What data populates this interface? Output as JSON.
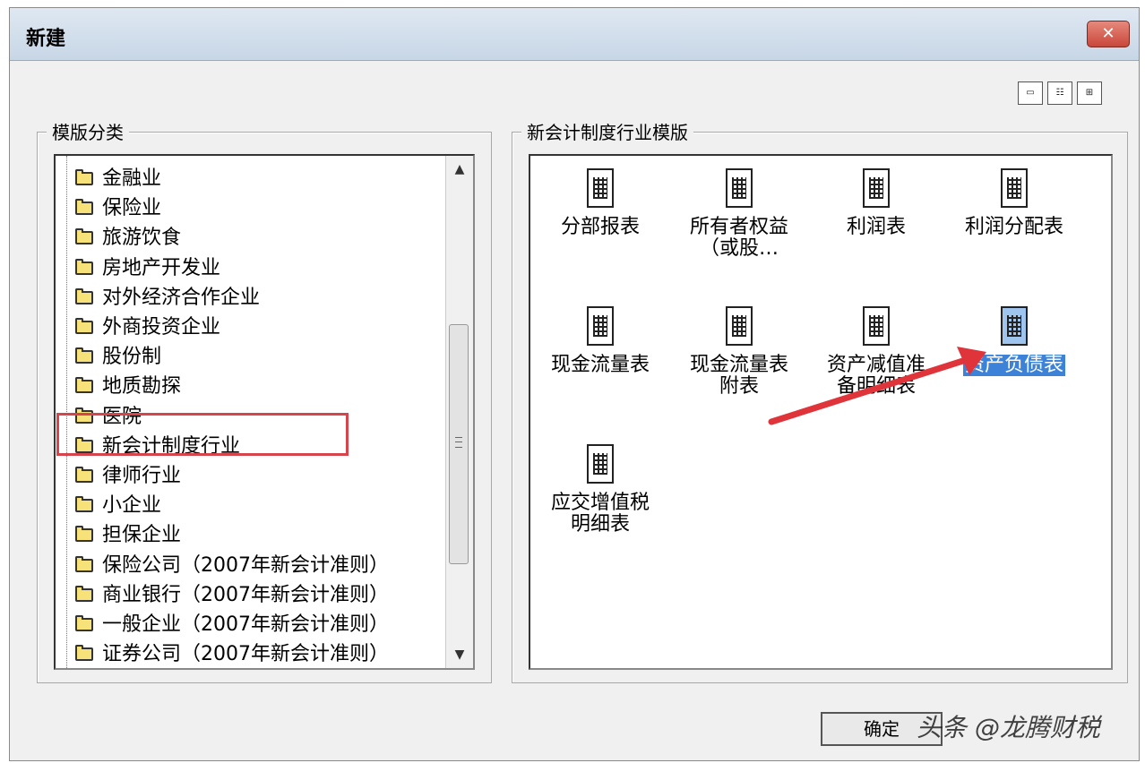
{
  "window": {
    "title": "新建",
    "close_symbol": "✕"
  },
  "view_buttons": [
    "▭",
    "☷",
    "⊞"
  ],
  "categories": {
    "label": "模版分类",
    "items": [
      "金融业",
      "保险业",
      "旅游饮食",
      "房地产开发业",
      "对外经济合作企业",
      "外商投资企业",
      "股份制",
      "地质勘探",
      "医院",
      "新会计制度行业",
      "律师行业",
      "小企业",
      "担保企业",
      "保险公司（2007年新会计准则）",
      "商业银行（2007年新会计准则）",
      "一般企业（2007年新会计准则）",
      "证券公司（2007年新会计准则）"
    ],
    "selected": "新会计制度行业"
  },
  "templates": {
    "label": "新会计制度行业模版",
    "items": [
      [
        "分部报表"
      ],
      [
        "所有者权益",
        "（或股…"
      ],
      [
        "利润表"
      ],
      [
        "利润分配表"
      ],
      [
        "现金流量表"
      ],
      [
        "现金流量表",
        "附表"
      ],
      [
        "资产减值准",
        "备明细表"
      ],
      [
        "资产负债表"
      ],
      [
        "应交增值税",
        "明细表"
      ]
    ],
    "selected": "资产负债表"
  },
  "buttons": {
    "ok": "确定"
  },
  "watermark": "头条 @龙腾财税",
  "colors": {
    "highlight_box": "#d6454b",
    "arrow": "#e0343b",
    "selection": "#3b82d8"
  }
}
